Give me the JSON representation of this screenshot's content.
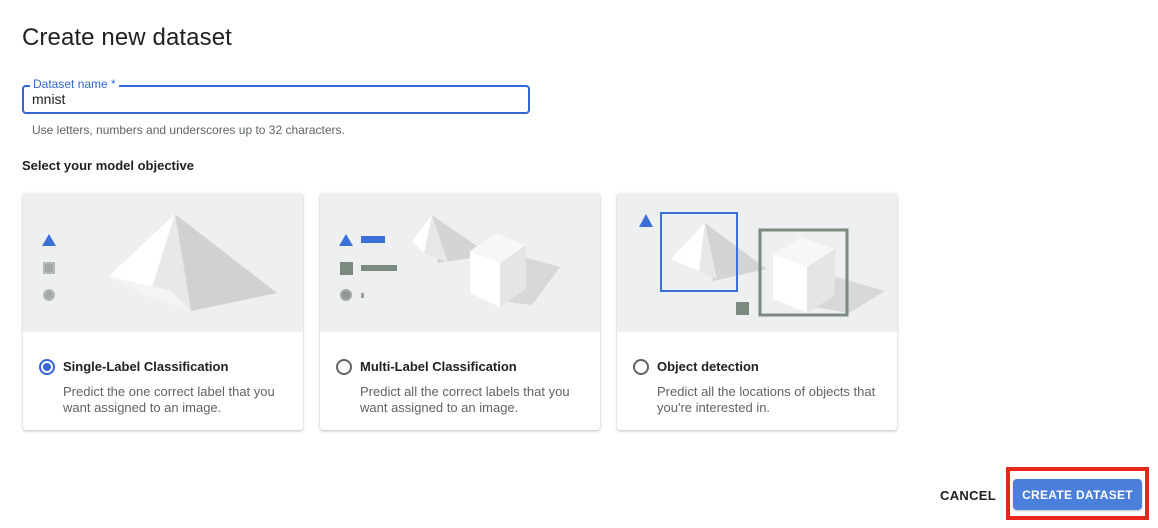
{
  "dialog": {
    "title": "Create new dataset"
  },
  "dataset_name": {
    "label": "Dataset name *",
    "value": "mnist",
    "hint": "Use letters, numbers and underscores up to 32 characters."
  },
  "objective": {
    "heading": "Select your model objective",
    "selected": "single-label",
    "options": [
      {
        "id": "single-label",
        "title": "Single-Label Classification",
        "description": "Predict the one correct label that you want assigned to an image.",
        "illustration": "single-pyramid-with-shape-labels"
      },
      {
        "id": "multi-label",
        "title": "Multi-Label Classification",
        "description": "Predict all the correct labels that you want assigned to an image.",
        "illustration": "pyramid-and-cube-with-shape-labels"
      },
      {
        "id": "object-detection",
        "title": "Object detection",
        "description": "Predict all the locations of objects that you're interested in.",
        "illustration": "pyramid-and-cube-with-bounding-boxes"
      }
    ]
  },
  "actions": {
    "cancel_label": "CANCEL",
    "create_label": "CREATE DATASET",
    "highlight_color": "#e8261b"
  },
  "colors": {
    "accent_blue": "#3367d6",
    "button_blue": "#4a7fdb",
    "label_gray": "#7b8a7e",
    "illustration_bg": "#eeeff1"
  }
}
